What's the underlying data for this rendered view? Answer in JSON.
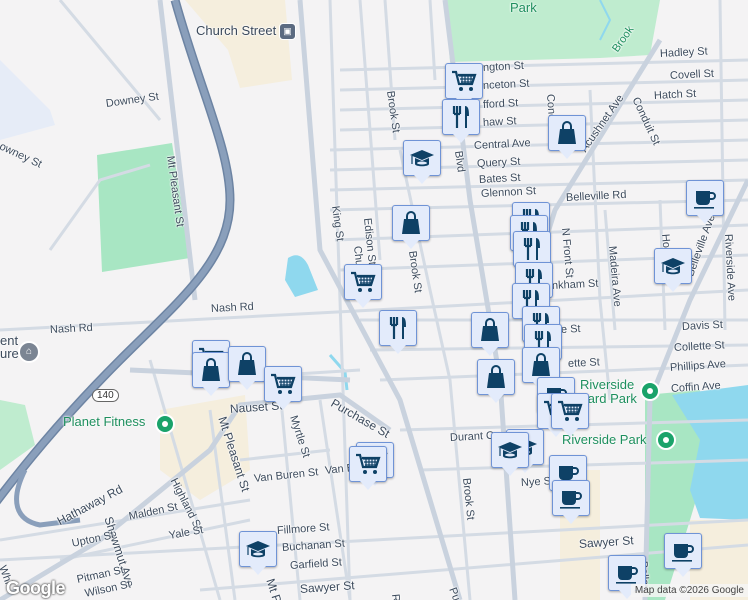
{
  "map": {
    "parks": [
      "Park",
      "Riverside Cemetery Yard Park",
      "Riverside Park",
      "Planet Fitness"
    ],
    "transit_station": "Church Street",
    "route_shield": "140",
    "civic_label": "ent\nure",
    "stream_label": "Brook",
    "streets": [
      "Downey St",
      "owney St",
      "Mt Pleasant St",
      "King St",
      "Edison St",
      "Church St",
      "Brook St",
      "Brook St",
      "Blvd",
      "Central Ave",
      "Query St",
      "Bates St",
      "Glennon St",
      "Belleville Rd",
      "N Front St",
      "Madeira Ave",
      "Hope St",
      "Belleville Ave",
      "Riverside Ave",
      "Acushnet Ave",
      "Conduit St",
      "Concord St",
      "Hadley St",
      "Covell St",
      "Hatch St",
      "ngton St",
      "nceton St",
      "fford St",
      "haw St",
      "nkham St",
      "Davis St",
      "Collette St",
      "Phillips Ave",
      "Coffin Ave",
      "Nash Rd",
      "Nash Rd",
      "Nauset St",
      "Purchase St",
      "Myrtle St",
      "Mt Pleasant St",
      "Van Buren St",
      "Van B",
      "Highland St",
      "Hathaway Rd",
      "Shawmut Ave",
      "Malden St",
      "Upton St",
      "Yale St",
      "Fillmore St",
      "Buchanan St",
      "Garfield St",
      "Pitman St",
      "Wilson St",
      "Sawyer St",
      "Sawyer St",
      "Durant C",
      "Nye St",
      "Brook St",
      "Mt Ple",
      "ette St",
      "e St",
      "Bellevi",
      "Whi",
      "Re",
      "Pu"
    ],
    "poi_park_brooklawn": "Park",
    "riverside_yard": "Riverside\nYard Park",
    "riverside_park": "Riverside Park",
    "planet_fitness": "Planet Fitness"
  },
  "markers": [
    {
      "type": "grocery",
      "icon": "cart-icon"
    },
    {
      "type": "restaurant",
      "icon": "fork-knife-icon"
    },
    {
      "type": "school",
      "icon": "graduation-cap-icon"
    },
    {
      "type": "shopping",
      "icon": "shopping-bag-icon"
    },
    {
      "type": "cafe",
      "icon": "coffee-cup-icon"
    }
  ],
  "footer": {
    "logo": "Google",
    "attribution": "Map data ©2026 Google"
  },
  "colors": {
    "marker_bg": "#e3ebfb",
    "marker_border": "#6f93d6",
    "marker_icon": "#0e4166",
    "highway": "#8a9fbb",
    "park": "#a8e6c3",
    "water": "#8fd8ee"
  }
}
